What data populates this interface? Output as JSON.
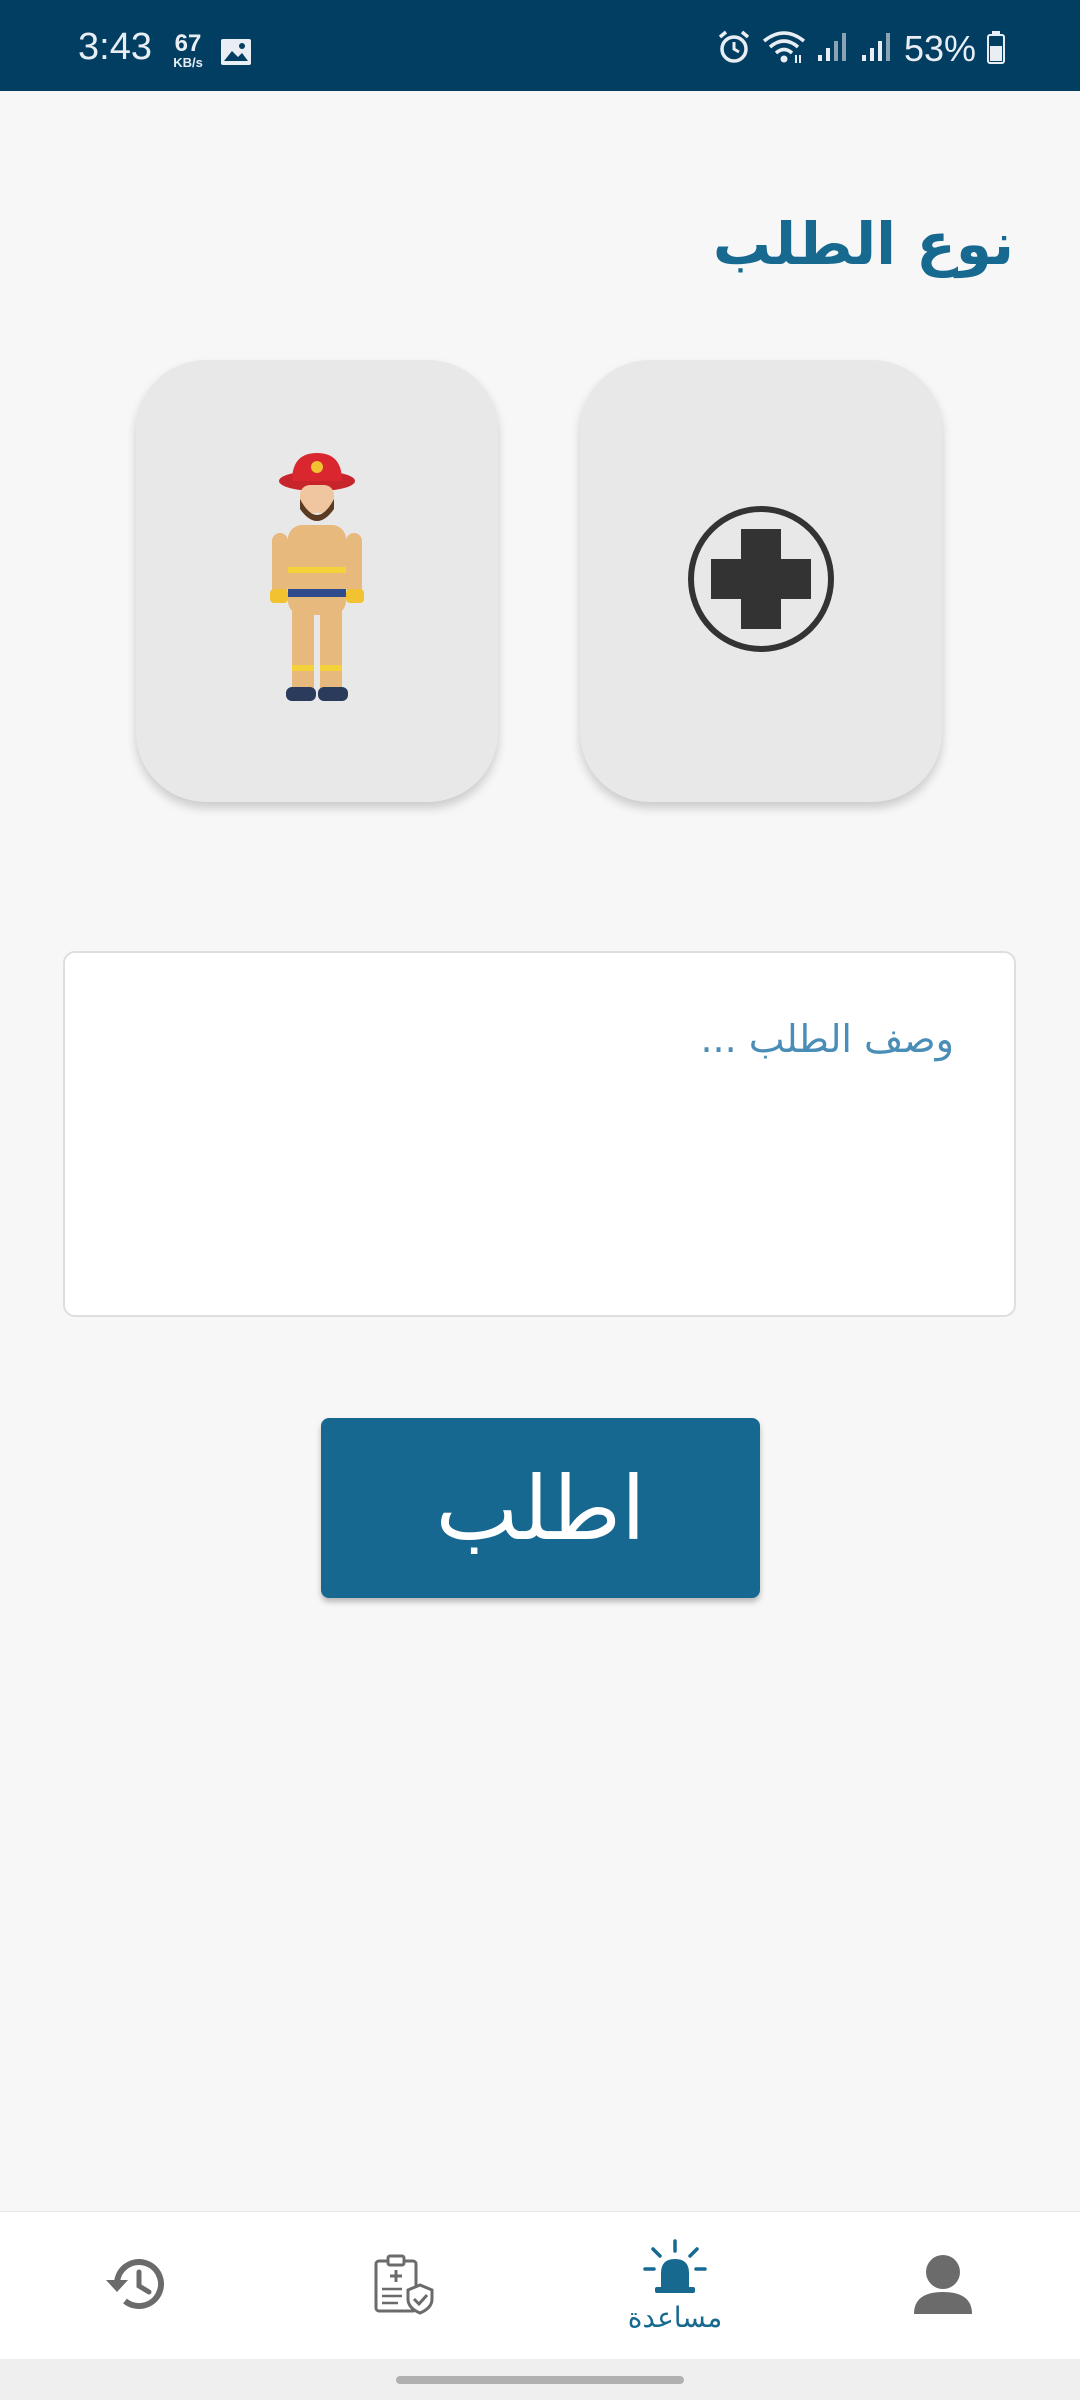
{
  "status_bar": {
    "time": "3:43",
    "net_speed_value": "67",
    "net_speed_unit": "KB/s",
    "battery": "53%",
    "icons": [
      "image-icon",
      "alarm-icon",
      "wifi-icon",
      "signal-icon",
      "signal-icon",
      "battery-icon"
    ]
  },
  "page": {
    "title": "نوع الطلب"
  },
  "request_types": [
    {
      "name": "firefighter",
      "icon": "firefighter-icon"
    },
    {
      "name": "medical",
      "icon": "medical-cross-icon"
    }
  ],
  "description": {
    "placeholder": "وصف الطلب ...",
    "value": ""
  },
  "submit": {
    "label": "اطلب"
  },
  "bottom_nav": {
    "items": [
      {
        "icon": "history-icon",
        "label": ""
      },
      {
        "icon": "medical-records-icon",
        "label": ""
      },
      {
        "icon": "siren-icon",
        "label": "مساعدة"
      },
      {
        "icon": "profile-icon",
        "label": ""
      }
    ],
    "active_color": "#17698f",
    "inactive_color": "#6b6b6b"
  },
  "colors": {
    "status_bar": "#023e62",
    "accent": "#17698f",
    "background": "#f7f7f7",
    "card": "#e8e8e8"
  }
}
